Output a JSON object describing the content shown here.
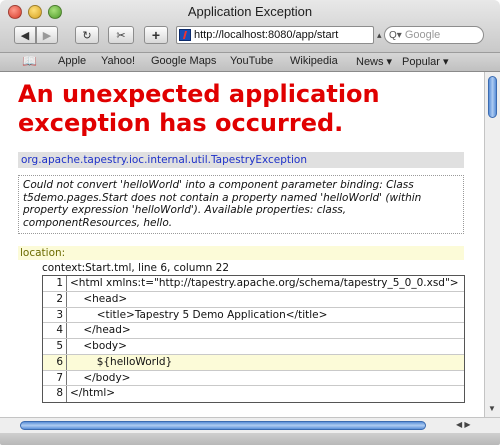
{
  "window": {
    "title": "Application Exception"
  },
  "toolbar": {
    "back_glyph": "◀",
    "forward_glyph": "▶",
    "reload_glyph": "↻",
    "snip_glyph": "✂",
    "add_glyph": "+",
    "address_url": "http://localhost:8080/app/start",
    "address_menu_glyph": "▴",
    "search_glyph": "Q▾",
    "search_placeholder": "Google"
  },
  "bookmarks": {
    "book_glyph": "📖",
    "items": [
      {
        "label": "Apple"
      },
      {
        "label": "Yahoo!"
      },
      {
        "label": "Google Maps"
      },
      {
        "label": "YouTube"
      },
      {
        "label": "Wikipedia"
      },
      {
        "label": "News ▾"
      },
      {
        "label": "Popular ▾"
      }
    ]
  },
  "page": {
    "heading": "An unexpected application exception has occurred.",
    "exception_class": "org.apache.tapestry.ioc.internal.util.TapestryException",
    "exception_message": "Could not convert 'helloWorld' into a component parameter binding: Class t5demo.pages.Start does not contain a property named 'helloWorld' (within property expression 'helloWorld'). Available properties: class, componentResources, hello.",
    "location_label": "location:",
    "location_desc": "context:Start.tml, line 6, column 22",
    "source_lines": [
      {
        "num": "1",
        "code": "<html xmlns:t=\"http://tapestry.apache.org/schema/tapestry_5_0_0.xsd\">"
      },
      {
        "num": "2",
        "code": "    <head>"
      },
      {
        "num": "3",
        "code": "        <title>Tapestry 5 Demo Application</title>"
      },
      {
        "num": "4",
        "code": "    </head>"
      },
      {
        "num": "5",
        "code": "    <body>"
      },
      {
        "num": "6",
        "code": "        ${helloWorld}"
      },
      {
        "num": "7",
        "code": "    </body>"
      },
      {
        "num": "8",
        "code": "</html>"
      }
    ],
    "highlighted_line": "6"
  },
  "colors": {
    "heading": "#e00000",
    "exception_class": "#1d30c8",
    "location_label": "#6b6b00",
    "highlight_bg": "#fcfbd8"
  },
  "scrollbars": {
    "vertical_down_glyph": "▼",
    "horizontal_arrows_glyph": "◀ ▶"
  }
}
